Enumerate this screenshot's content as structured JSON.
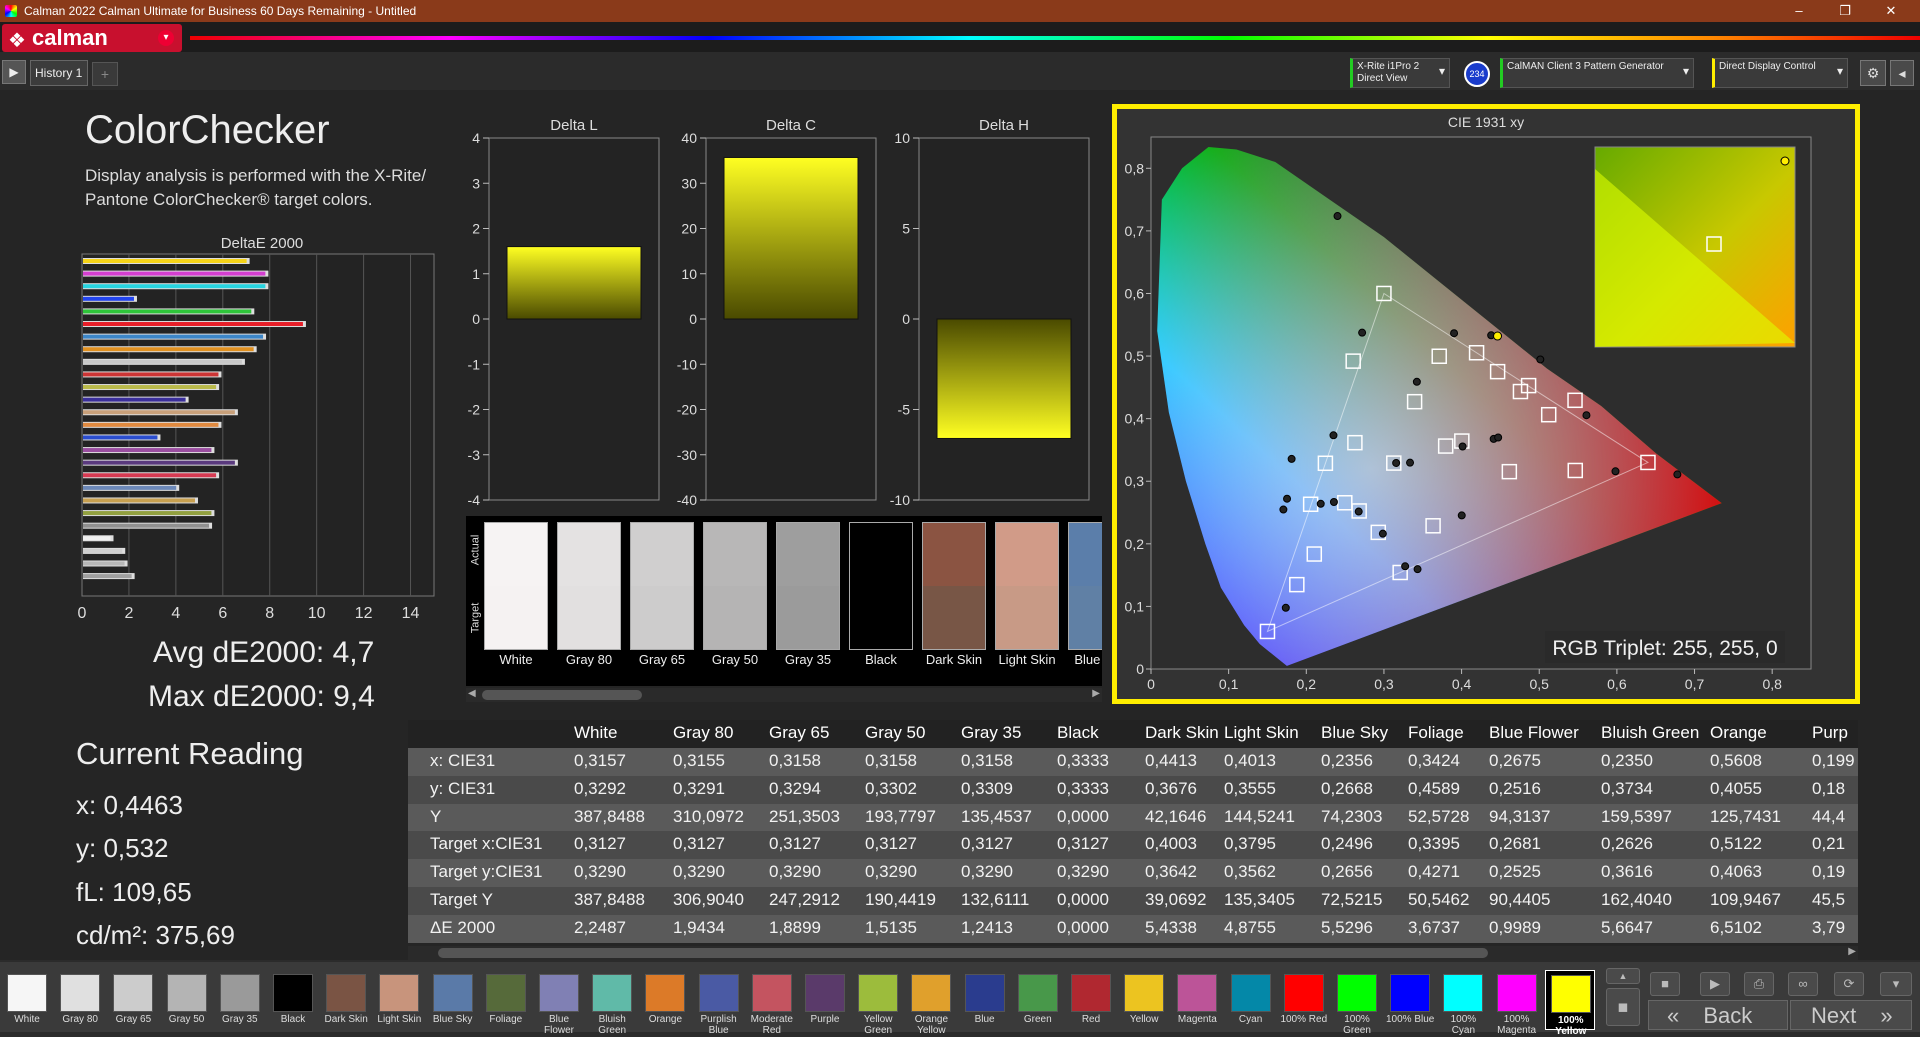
{
  "window": {
    "title": "Calman 2022 Calman Ultimate for Business 60 Days Remaining  - Untitled",
    "min": "–",
    "max": "❐",
    "close": "✕"
  },
  "app": {
    "logo": "calman",
    "logo_icon": "calman-logo-icon",
    "dropdown": "▾"
  },
  "tabs": {
    "play": "▶",
    "history": "History 1",
    "add": "+"
  },
  "devices": [
    {
      "line1": "X-Rite i1Pro 2",
      "line2": "Direct View",
      "accent": "#22cc22"
    },
    {
      "badge": "234"
    },
    {
      "line1": "CalMAN Client 3 Pattern Generator",
      "line2": "",
      "accent": "#22cc22"
    },
    {
      "line1": "Direct Display Control",
      "line2": "",
      "accent": "#ffee00"
    }
  ],
  "header": {
    "title": "ColorChecker",
    "description": "Display analysis is performed with the X-Rite/ Pantone ColorChecker® target colors."
  },
  "stats": {
    "avg": "Avg dE2000: 4,7",
    "max": "Max dE2000: 9,4"
  },
  "current_reading": {
    "title": "Current Reading",
    "x": "x: 0,4463",
    "y": "y: 0,532",
    "fl": "fL: 109,65",
    "cd": "cd/m²: 375,69"
  },
  "chart_data": [
    {
      "type": "bar",
      "title": "DeltaE 2000",
      "orientation": "horizontal",
      "xlim": [
        0,
        15
      ],
      "ticks": [
        0,
        2,
        4,
        6,
        8,
        10,
        12,
        14
      ],
      "values": [
        7.1,
        7.9,
        7.9,
        2.3,
        7.3,
        9.5,
        7.8,
        7.4,
        6.9,
        5.9,
        5.8,
        4.5,
        6.6,
        5.9,
        3.3,
        5.6,
        6.6,
        5.8,
        4.1,
        4.9,
        5.6,
        5.5,
        1.3,
        1.8,
        1.9,
        2.2
      ],
      "colors": [
        "#f5d318",
        "#d43fd0",
        "#27d4e0",
        "#2244ee",
        "#2ec43a",
        "#e81e28",
        "#3c86c8",
        "#e09020",
        "#c8c8c8",
        "#cc3535",
        "#b9b94a",
        "#3a2f9a",
        "#c8a07a",
        "#e08a40",
        "#2a4dcf",
        "#9a4ea0",
        "#5a3a7e",
        "#d63a52",
        "#6c88b8",
        "#c8a050",
        "#92a040",
        "#909090",
        "#f0f0f0",
        "#cfcfcf",
        "#b8b8b8",
        "#a0a0a0"
      ]
    },
    {
      "type": "bar",
      "title": "Delta L",
      "ylim": [
        -4,
        4
      ],
      "ticks": [
        4,
        3,
        2,
        1,
        0,
        -1,
        -2,
        -3,
        -4
      ],
      "values": [
        1.6
      ]
    },
    {
      "type": "bar",
      "title": "Delta C",
      "ylim": [
        -40,
        40
      ],
      "ticks": [
        40,
        30,
        20,
        10,
        0,
        -10,
        -20,
        -30,
        -40
      ],
      "values": [
        35.7
      ]
    },
    {
      "type": "bar",
      "title": "Delta H",
      "ylim": [
        -10,
        10
      ],
      "ticks": [
        10,
        5,
        0,
        -5,
        -10
      ],
      "values": [
        -6.6
      ]
    },
    {
      "type": "scatter",
      "title": "CIE 1931 xy",
      "xlim": [
        0,
        0.85
      ],
      "ylim": [
        0,
        0.85
      ],
      "xticks": [
        "0",
        "0,1",
        "0,2",
        "0,3",
        "0,4",
        "0,5",
        "0,6",
        "0,7",
        "0,8"
      ],
      "yticks": [
        "0",
        "0,1",
        "0,2",
        "0,3",
        "0,4",
        "0,5",
        "0,6",
        "0,7",
        "0,8"
      ],
      "gamut": [
        [
          0.64,
          0.33
        ],
        [
          0.3,
          0.6
        ],
        [
          0.15,
          0.06
        ]
      ],
      "targets": [
        [
          0.3127,
          0.329
        ],
        [
          0.3,
          0.6
        ],
        [
          0.15,
          0.06
        ],
        [
          0.64,
          0.33
        ],
        [
          0.2246,
          0.3287
        ],
        [
          0.3209,
          0.1542
        ],
        [
          0.4193,
          0.5053
        ],
        [
          0.4003,
          0.3642
        ],
        [
          0.3795,
          0.3562
        ],
        [
          0.2496,
          0.2656
        ],
        [
          0.3395,
          0.4271
        ],
        [
          0.2681,
          0.2525
        ],
        [
          0.2626,
          0.3616
        ],
        [
          0.5122,
          0.4063
        ],
        [
          0.2103,
          0.1837
        ],
        [
          0.4615,
          0.3153
        ],
        [
          0.2927,
          0.2183
        ],
        [
          0.3712,
          0.4997
        ],
        [
          0.4758,
          0.4433
        ],
        [
          0.1878,
          0.1348
        ],
        [
          0.2604,
          0.4919
        ],
        [
          0.5464,
          0.3172
        ],
        [
          0.4464,
          0.4751
        ],
        [
          0.3633,
          0.2288
        ],
        [
          0.2056,
          0.2632
        ],
        [
          0.4863,
          0.4528
        ],
        [
          0.5461,
          0.4293
        ]
      ],
      "measured": [
        [
          0.3157,
          0.3292
        ],
        [
          0.2719,
          0.5374
        ],
        [
          0.1736,
          0.0978
        ],
        [
          0.6779,
          0.3109
        ],
        [
          0.1811,
          0.3357
        ],
        [
          0.3433,
          0.1595
        ],
        [
          0.4381,
          0.5332
        ],
        [
          0.4413,
          0.3676
        ],
        [
          0.4013,
          0.3555
        ],
        [
          0.2356,
          0.2668
        ],
        [
          0.3424,
          0.4589
        ],
        [
          0.2675,
          0.2516
        ],
        [
          0.235,
          0.3734
        ],
        [
          0.5608,
          0.4055
        ],
        [
          0.1752,
          0.2721
        ],
        [
          0.4471,
          0.3699
        ],
        [
          0.2986,
          0.2162
        ],
        [
          0.3903,
          0.5365
        ],
        [
          0.5014,
          0.4946
        ],
        [
          0.2186,
          0.264
        ],
        [
          0.2402,
          0.7237
        ],
        [
          0.5982,
          0.3159
        ],
        [
          0.4463,
          0.532
        ],
        [
          0.3273,
          0.1641
        ],
        [
          0.1705,
          0.2548
        ],
        [
          0.3336,
          0.3297
        ],
        [
          0.4002,
          0.2454
        ]
      ],
      "current": [
        0.4463,
        0.532
      ]
    }
  ],
  "gamut_readout": "RGB Triplet: 255, 255, 0",
  "patches": [
    {
      "name": "White",
      "actual": "#f6f3f3",
      "target": "#f5f2f2"
    },
    {
      "name": "Gray 80",
      "actual": "#e4e2e2",
      "target": "#e2e0e0"
    },
    {
      "name": "Gray 65",
      "actual": "#d0cfcf",
      "target": "#cdcccc"
    },
    {
      "name": "Gray 50",
      "actual": "#b8b7b7",
      "target": "#b5b4b4"
    },
    {
      "name": "Gray 35",
      "actual": "#9e9e9e",
      "target": "#9b9b9b"
    },
    {
      "name": "Black",
      "actual": "#000000",
      "target": "#000000"
    },
    {
      "name": "Dark Skin",
      "actual": "#8b5442",
      "target": "#785646"
    },
    {
      "name": "Light Skin",
      "actual": "#d19b88",
      "target": "#c89a86"
    },
    {
      "name": "Blue Sky",
      "actual": "#5b7eaa",
      "target": "#6080a5"
    }
  ],
  "table": {
    "columns": [
      "White",
      "Gray 80",
      "Gray 65",
      "Gray 50",
      "Gray 35",
      "Black",
      "Dark Skin",
      "Light Skin",
      "Blue Sky",
      "Foliage",
      "Blue Flower",
      "Bluish Green",
      "Orange",
      "Purp"
    ],
    "rows": [
      {
        "label": "x: CIE31",
        "values": [
          "0,3157",
          "0,3155",
          "0,3158",
          "0,3158",
          "0,3158",
          "0,3333",
          "0,4413",
          "0,4013",
          "0,2356",
          "0,3424",
          "0,2675",
          "0,2350",
          "0,5608",
          "0,199"
        ]
      },
      {
        "label": "y: CIE31",
        "values": [
          "0,3292",
          "0,3291",
          "0,3294",
          "0,3302",
          "0,3309",
          "0,3333",
          "0,3676",
          "0,3555",
          "0,2668",
          "0,4589",
          "0,2516",
          "0,3734",
          "0,4055",
          "0,18"
        ]
      },
      {
        "label": "Y",
        "values": [
          "387,8488",
          "310,0972",
          "251,3503",
          "193,7797",
          "135,4537",
          "0,0000",
          "42,1646",
          "144,5241",
          "74,2303",
          "52,5728",
          "94,3137",
          "159,5397",
          "125,7431",
          "44,4"
        ]
      },
      {
        "label": "Target x:CIE31",
        "values": [
          "0,3127",
          "0,3127",
          "0,3127",
          "0,3127",
          "0,3127",
          "0,3127",
          "0,4003",
          "0,3795",
          "0,2496",
          "0,3395",
          "0,2681",
          "0,2626",
          "0,5122",
          "0,21"
        ]
      },
      {
        "label": "Target y:CIE31",
        "values": [
          "0,3290",
          "0,3290",
          "0,3290",
          "0,3290",
          "0,3290",
          "0,3290",
          "0,3642",
          "0,3562",
          "0,2656",
          "0,4271",
          "0,2525",
          "0,3616",
          "0,4063",
          "0,19"
        ]
      },
      {
        "label": "Target Y",
        "values": [
          "387,8488",
          "306,9040",
          "247,2912",
          "190,4419",
          "132,6111",
          "0,0000",
          "39,0692",
          "135,3405",
          "72,5215",
          "50,5462",
          "90,4405",
          "162,4040",
          "109,9467",
          "45,5"
        ]
      },
      {
        "label": "ΔE 2000",
        "values": [
          "2,2487",
          "1,9434",
          "1,8899",
          "1,5135",
          "1,2413",
          "0,0000",
          "5,4338",
          "4,8755",
          "5,5296",
          "3,6737",
          "0,9989",
          "5,6647",
          "6,5102",
          "3,79"
        ]
      }
    ]
  },
  "bottom_patches": [
    {
      "label": "White",
      "color": "#f6f6f6"
    },
    {
      "label": "Gray 80",
      "color": "#e0e0e0"
    },
    {
      "label": "Gray 65",
      "color": "#cccccc"
    },
    {
      "label": "Gray 50",
      "color": "#b4b4b4"
    },
    {
      "label": "Gray 35",
      "color": "#9a9a9a"
    },
    {
      "label": "Black",
      "color": "#000000"
    },
    {
      "label": "Dark Skin",
      "color": "#7a5444"
    },
    {
      "label": "Light Skin",
      "color": "#c8947c"
    },
    {
      "label": "Blue Sky",
      "color": "#5a7aa8"
    },
    {
      "label": "Foliage",
      "color": "#566a3a"
    },
    {
      "label": "Blue Flower",
      "color": "#8080b4"
    },
    {
      "label": "Bluish Green",
      "color": "#60baa8"
    },
    {
      "label": "Orange",
      "color": "#dc7a28"
    },
    {
      "label": "Purplish Blue",
      "color": "#4a5aa4"
    },
    {
      "label": "Moderate Red",
      "color": "#c45460"
    },
    {
      "label": "Purple",
      "color": "#5a3a6a"
    },
    {
      "label": "Yellow Green",
      "color": "#9cbc3c"
    },
    {
      "label": "Orange Yellow",
      "color": "#e0a02c"
    },
    {
      "label": "Blue",
      "color": "#2a3c8e"
    },
    {
      "label": "Green",
      "color": "#48984a"
    },
    {
      "label": "Red",
      "color": "#b02830"
    },
    {
      "label": "Yellow",
      "color": "#ecc420"
    },
    {
      "label": "Magenta",
      "color": "#bc5498"
    },
    {
      "label": "Cyan",
      "color": "#0488a8"
    },
    {
      "label": "100% Red",
      "color": "#ff0000"
    },
    {
      "label": "100% Green",
      "color": "#00ff00"
    },
    {
      "label": "100% Blue",
      "color": "#0000ff"
    },
    {
      "label": "100% Cyan",
      "color": "#00ffff"
    },
    {
      "label": "100% Magenta",
      "color": "#ff00ff"
    },
    {
      "label": "100% Yellow",
      "color": "#ffff00",
      "selected": true
    }
  ],
  "nav": {
    "back": "Back",
    "next": "Next"
  },
  "colors": {
    "accent_yellow": "#ffee00",
    "brand_red": "#c8102e"
  }
}
